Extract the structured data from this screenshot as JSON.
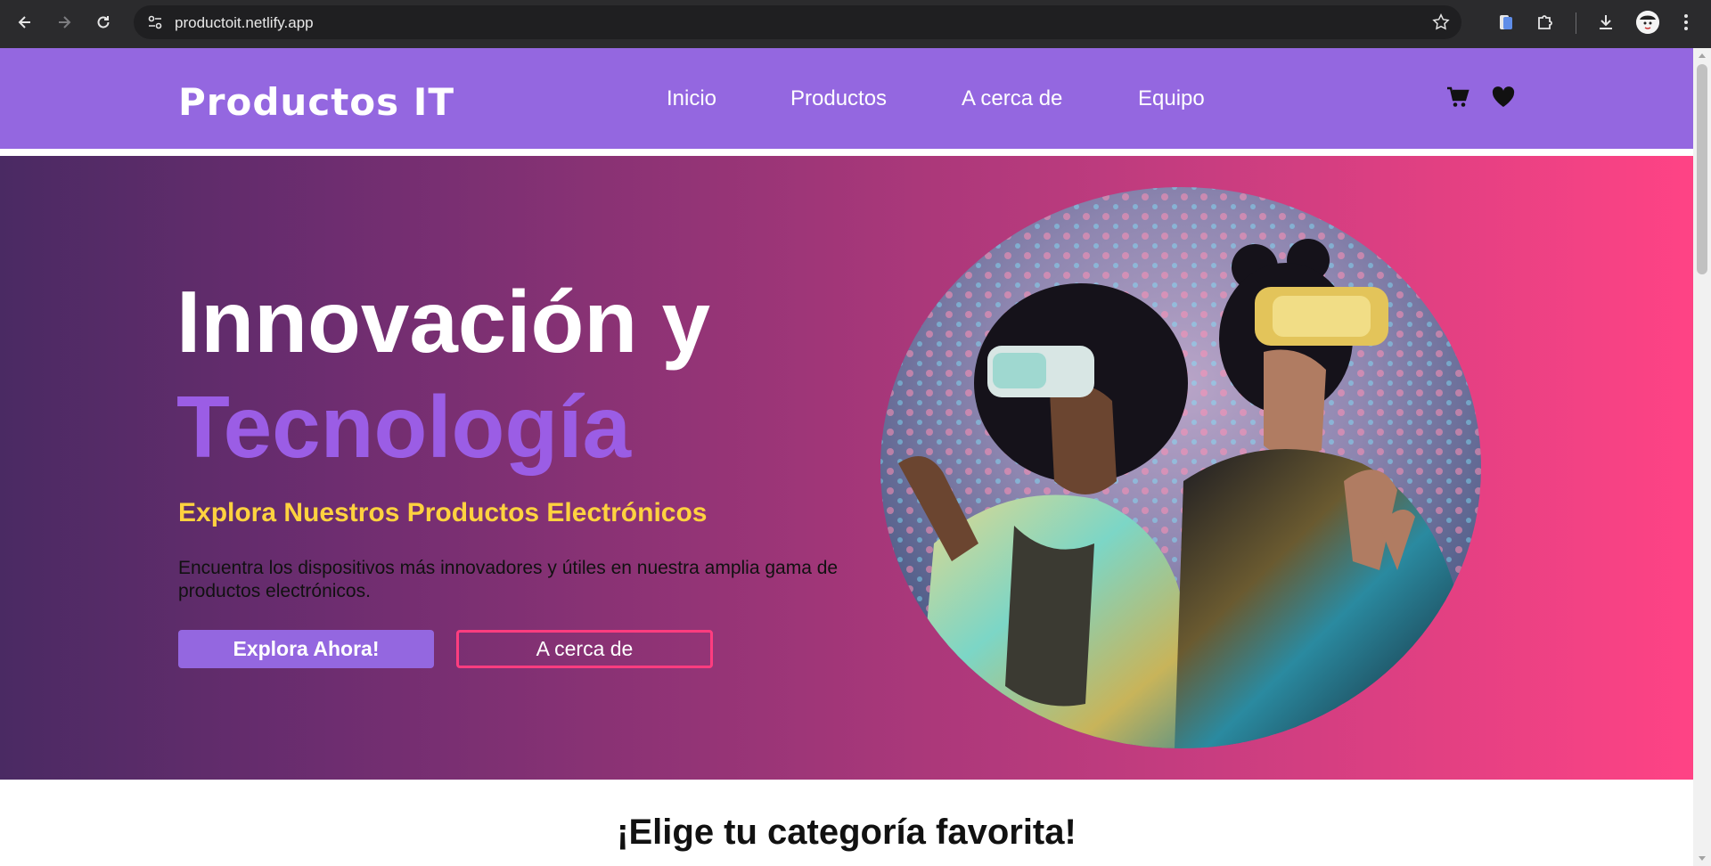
{
  "browser": {
    "url": "productoit.netlify.app"
  },
  "header": {
    "logo": "Productos IT",
    "nav": [
      "Inicio",
      "Productos",
      "A cerca de",
      "Equipo"
    ],
    "icons": [
      "cart-icon",
      "heart-icon"
    ]
  },
  "hero": {
    "title_line1": "Innovación y",
    "title_line2": "Tecnología",
    "subtitle": "Explora Nuestros Productos Electrónicos",
    "text": "Encuentra los dispositivos más innovadores y útiles en nuestra amplia gama de productos electrónicos.",
    "primary_button": "Explora Ahora!",
    "secondary_button": "A cerca de"
  },
  "categories": {
    "title": "¡Elige tu categoría favorita!"
  },
  "colors": {
    "header_bg": "#9467e0",
    "accent_purple": "#9b5de5",
    "accent_yellow": "#ffd23f",
    "accent_pink": "#ff3d7f"
  }
}
